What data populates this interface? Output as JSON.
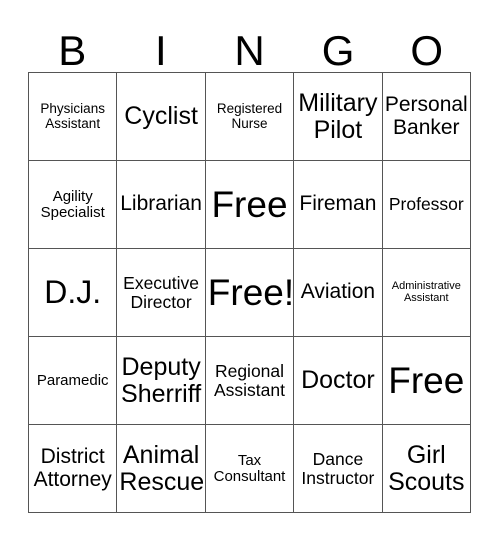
{
  "card": {
    "title": "BINGO Card",
    "header_letters": [
      "B",
      "I",
      "N",
      "G",
      "O"
    ],
    "border_color": "#555555",
    "text_color": "#000000",
    "background_color": "#ffffff",
    "columns": 5,
    "rows": 5
  },
  "cells": [
    {
      "text": "Physicians\nAssistant",
      "size": "s-sm",
      "row": 1,
      "col": 1
    },
    {
      "text": "Cyclist",
      "size": "s-xxl",
      "row": 1,
      "col": 2
    },
    {
      "text": "Registered\nNurse",
      "size": "s-sm",
      "row": 1,
      "col": 3
    },
    {
      "text": "Military\nPilot",
      "size": "s-xxl",
      "row": 1,
      "col": 4
    },
    {
      "text": "Personal\nBanker",
      "size": "s-xl",
      "row": 1,
      "col": 5
    },
    {
      "text": "Agility\nSpecialist",
      "size": "s-md",
      "row": 2,
      "col": 1
    },
    {
      "text": "Librarian",
      "size": "s-xl",
      "row": 2,
      "col": 2
    },
    {
      "text": "Free",
      "size": "s-mega",
      "row": 2,
      "col": 3
    },
    {
      "text": "Fireman",
      "size": "s-xl",
      "row": 2,
      "col": 4
    },
    {
      "text": "Professor",
      "size": "s-lg",
      "row": 2,
      "col": 5
    },
    {
      "text": "D.J.",
      "size": "s-huge",
      "row": 3,
      "col": 1
    },
    {
      "text": "Executive\nDirector",
      "size": "s-lg",
      "row": 3,
      "col": 2
    },
    {
      "text": "Free!",
      "size": "s-mega",
      "row": 3,
      "col": 3
    },
    {
      "text": "Aviation",
      "size": "s-xl",
      "row": 3,
      "col": 4
    },
    {
      "text": "Administrative\nAssistant",
      "size": "s-xs",
      "row": 3,
      "col": 5
    },
    {
      "text": "Paramedic",
      "size": "s-md",
      "row": 4,
      "col": 1
    },
    {
      "text": "Deputy\nSherriff",
      "size": "s-xxl",
      "row": 4,
      "col": 2
    },
    {
      "text": "Regional\nAssistant",
      "size": "s-lg",
      "row": 4,
      "col": 3
    },
    {
      "text": "Doctor",
      "size": "s-xxl",
      "row": 4,
      "col": 4
    },
    {
      "text": "Free",
      "size": "s-mega",
      "row": 4,
      "col": 5
    },
    {
      "text": "District\nAttorney",
      "size": "s-xl",
      "row": 5,
      "col": 1
    },
    {
      "text": "Animal\nRescue",
      "size": "s-xxl",
      "row": 5,
      "col": 2
    },
    {
      "text": "Tax\nConsultant",
      "size": "s-md",
      "row": 5,
      "col": 3
    },
    {
      "text": "Dance\nInstructor",
      "size": "s-lg",
      "row": 5,
      "col": 4
    },
    {
      "text": "Girl\nScouts",
      "size": "s-xxl",
      "row": 5,
      "col": 5
    }
  ]
}
